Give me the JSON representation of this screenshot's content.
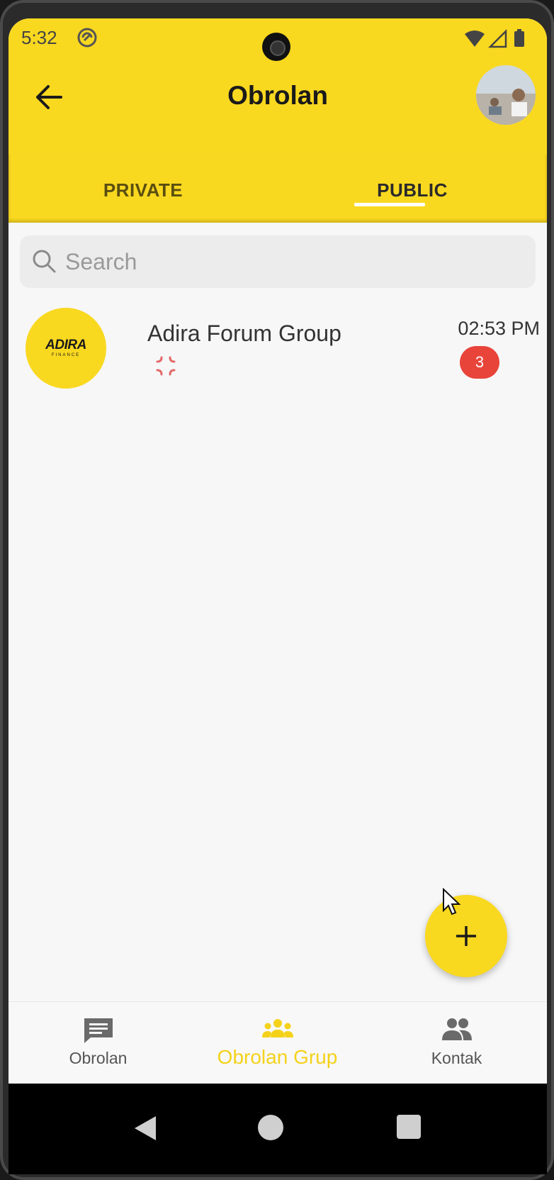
{
  "status_bar": {
    "time": "5:32"
  },
  "header": {
    "title": "Obrolan"
  },
  "tabs": [
    {
      "label": "PRIVATE",
      "active": false
    },
    {
      "label": "PUBLIC",
      "active": true
    }
  ],
  "search": {
    "placeholder": "Search",
    "value": ""
  },
  "chats": [
    {
      "name": "Adira Forum Group",
      "time": "02:53 PM",
      "unread": "3",
      "logo_text": "ADIRA",
      "logo_sub": "FINANCE",
      "last_message_icon": "anger-emoji-icon"
    }
  ],
  "fab": {
    "icon": "plus-icon"
  },
  "bottom_nav": {
    "items": [
      {
        "label": "Obrolan",
        "icon": "chat-icon",
        "active": false
      },
      {
        "label": "Obrolan Grup",
        "icon": "group-icon",
        "active": true
      },
      {
        "label": "Kontak",
        "icon": "contacts-icon",
        "active": false
      }
    ]
  },
  "colors": {
    "accent": "#f9d820",
    "badge": "#e8443a",
    "background": "#f7f7f7"
  }
}
